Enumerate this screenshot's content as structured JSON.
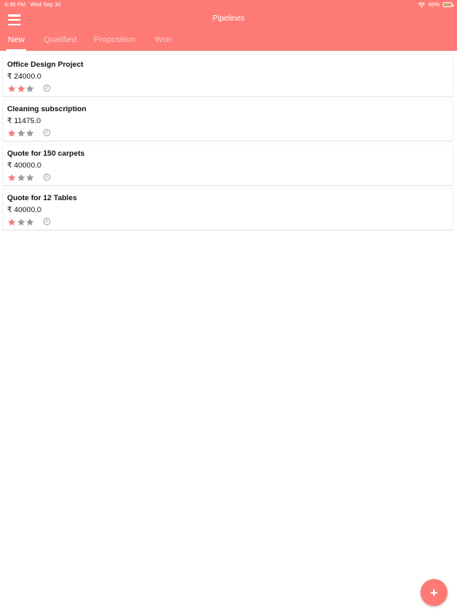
{
  "status_bar": {
    "time": "6:36 PM",
    "date": "Wed Sep 30",
    "battery": "89%",
    "battery_level": 0.89
  },
  "app_bar": {
    "title": "Pipelines",
    "color": "#fd7a75",
    "menu_icon": "hamburger-menu-icon"
  },
  "tabs": [
    {
      "label": "New",
      "active": true
    },
    {
      "label": "Qualified",
      "active": false
    },
    {
      "label": "Proposition",
      "active": false
    },
    {
      "label": "Won",
      "active": false
    }
  ],
  "opportunities": [
    {
      "title": "Office Design Project",
      "amount": "₹ 24000.0",
      "rating": 2,
      "max_rating": 3
    },
    {
      "title": "Cleaning subscription",
      "amount": "₹ 11475.0",
      "rating": 1,
      "max_rating": 3
    },
    {
      "title": "Quote for 150 carpets",
      "amount": "₹ 40000.0",
      "rating": 1,
      "max_rating": 3
    },
    {
      "title": "Quote for 12 Tables",
      "amount": "₹ 40000.0",
      "rating": 1,
      "max_rating": 3
    }
  ],
  "colors": {
    "star_filled": "#f47c79",
    "star_empty": "#9a9a9a",
    "clock": "#9a9a9a"
  },
  "fab": {
    "label": "+",
    "icon": "plus-icon"
  }
}
